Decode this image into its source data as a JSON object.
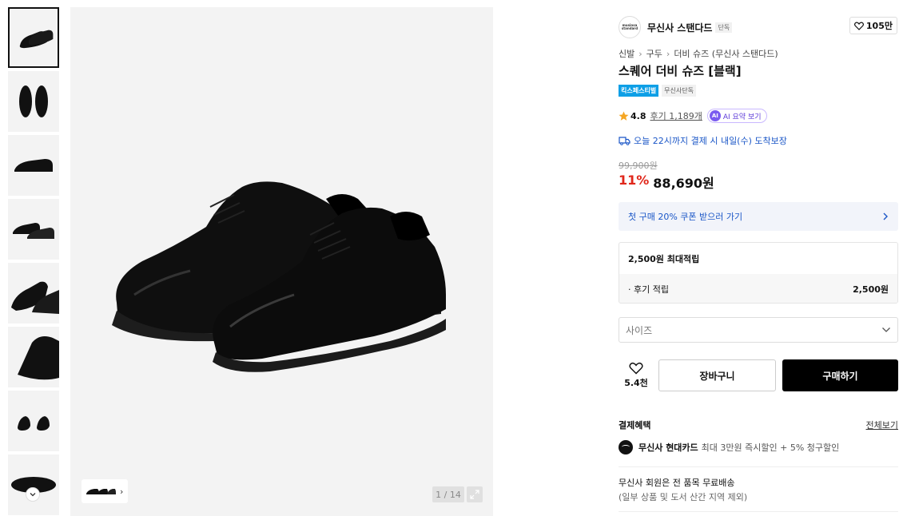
{
  "brand": {
    "logo_text": "musinsa standard",
    "name": "무신사 스탠다드",
    "tag": "단독",
    "likes": "105만"
  },
  "breadcrumb": [
    "신발",
    "구두",
    "더비 슈즈 (무신사 스탠다드)"
  ],
  "product": {
    "title": "스퀘어 더비 슈즈 [블랙]",
    "badge_primary": "킥스페스티벌",
    "badge_secondary": "무신사단독",
    "rating": "4.8",
    "reviews": "후기 1,189개",
    "ai_summary": "AI 요약 보기",
    "ai_mark": "AI",
    "delivery": "오늘 22시까지 결제 시 내일(수) 도착보장",
    "original_price": "99,900원",
    "discount": "11%",
    "price": "88,690원"
  },
  "coupon": {
    "label": "첫 구매 20% 쿠폰 받으러 가기"
  },
  "points": {
    "header": "2,500원 최대적립",
    "row_label": "· 후기 적립",
    "row_value": "2,500원"
  },
  "size_select": {
    "placeholder": "사이즈"
  },
  "actions": {
    "wish_count": "5.4천",
    "cart_label": "장바구니",
    "buy_label": "구매하기"
  },
  "payment": {
    "heading": "결제혜택",
    "view_all": "전체보기",
    "card_name": "무신사 현대카드",
    "card_desc": "최대 3만원 즉시할인 + 5% 청구할인"
  },
  "shipping": {
    "line1": "무신사 회원은 전 품목 무료배송",
    "line2": "(일부 상품 및 도서 산간 지역 제외)"
  },
  "gallery": {
    "counter": "1 / 14"
  },
  "colors": {
    "accent_blue": "#1a56c7",
    "discount_red": "#e0271b",
    "badge_blue": "#0e9fe6",
    "buy_button": "#000000"
  }
}
